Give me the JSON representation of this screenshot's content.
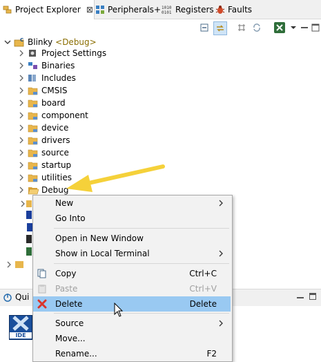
{
  "tabs": [
    {
      "label": "Project Explorer",
      "close": "⊠",
      "active": true
    },
    {
      "label": "Peripherals+"
    },
    {
      "label": "Registers"
    },
    {
      "label": "Faults"
    }
  ],
  "tree": {
    "project": {
      "name": "Blinky",
      "config": "<Debug>"
    },
    "items": [
      {
        "label": "Project Settings",
        "icon": "settings-icon"
      },
      {
        "label": "Binaries",
        "icon": "binaries-icon"
      },
      {
        "label": "Includes",
        "icon": "includes-icon"
      },
      {
        "label": "CMSIS",
        "icon": "folder-icon"
      },
      {
        "label": "board",
        "icon": "folder-icon"
      },
      {
        "label": "component",
        "icon": "folder-icon"
      },
      {
        "label": "device",
        "icon": "folder-icon"
      },
      {
        "label": "drivers",
        "icon": "folder-icon"
      },
      {
        "label": "source",
        "icon": "folder-icon"
      },
      {
        "label": "startup",
        "icon": "folder-icon"
      },
      {
        "label": "utilities",
        "icon": "folder-icon"
      },
      {
        "label": "Debug",
        "icon": "folder-open-icon"
      }
    ]
  },
  "bottom_panel": {
    "tab_label": "Qui",
    "logo_text": "IDE"
  },
  "context_menu": {
    "items": [
      {
        "label": "New",
        "submenu": true
      },
      {
        "label": "Go Into"
      },
      {
        "label": "Open in New Window"
      },
      {
        "label": "Show in Local Terminal",
        "submenu": true
      },
      {
        "label": "Copy",
        "shortcut": "Ctrl+C"
      },
      {
        "label": "Paste",
        "shortcut": "Ctrl+V",
        "disabled": true
      },
      {
        "label": "Delete",
        "shortcut": "Delete",
        "highlighted": true
      },
      {
        "label": "Source",
        "submenu": true
      },
      {
        "label": "Move..."
      },
      {
        "label": "Rename...",
        "shortcut": "F2"
      }
    ]
  },
  "colors": {
    "highlight": "#99c9f2",
    "arrow": "#f5d13a",
    "folder": "#e8b64c",
    "delete_icon": "#d9342b",
    "project_config": "#8a6d00"
  }
}
